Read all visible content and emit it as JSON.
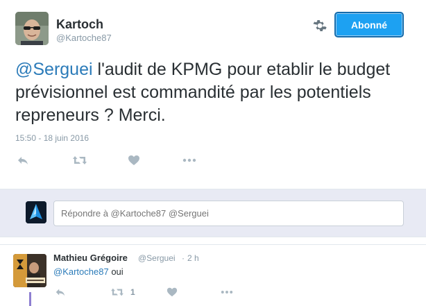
{
  "main_tweet": {
    "author_name": "Kartoch",
    "author_handle": "@Kartoche87",
    "follow_button_label": "Abonné",
    "text_mention": "@Serguei",
    "text_body": " l'audit de KPMG pour etablir le budget prévisionnel est commandité par les potentiels repreneurs ? Merci.",
    "timestamp": "15:50 - 18 juin 2016",
    "actions": [
      "reply-icon",
      "retweet-icon",
      "like-icon",
      "more-icon"
    ]
  },
  "composer": {
    "placeholder": "Répondre à @Kartoche87 @Serguei"
  },
  "reply_tweet": {
    "author_name": "Mathieu Grégoire",
    "author_handle": "@Serguei",
    "separator": "·",
    "time": "2 h",
    "text_mention": "@Kartoche87",
    "text_body": " oui",
    "retweet_count": "1",
    "actions": [
      "reply-icon",
      "retweet-icon",
      "like-icon",
      "more-icon"
    ]
  },
  "colors": {
    "accent": "#1da1f2",
    "mention": "#2b7bb9",
    "muted": "#8899a6",
    "composer_bg": "#e8eaf4",
    "thread_line": "#8e7fd1"
  }
}
